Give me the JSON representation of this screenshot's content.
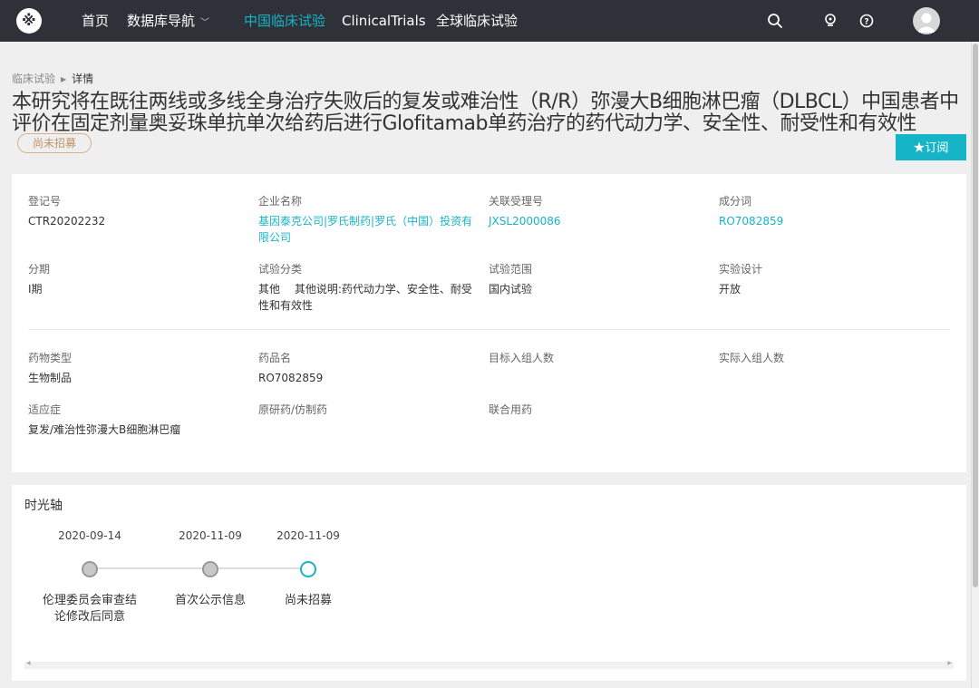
{
  "nav": {
    "items": [
      "首页",
      "数据库导航",
      "中国临床试验",
      "ClinicalTrials",
      "全球临床试验"
    ],
    "active_index": 2,
    "accent_color": "#16b4c7",
    "icons": [
      "search-icon",
      "bulb-icon",
      "help-icon",
      "user-avatar"
    ]
  },
  "breadcrumb": {
    "parent": "临床试验",
    "current": "详情"
  },
  "title": "本研究将在既往两线或多线全身治疗失败后的复发或难治性（R/R）弥漫大B细胞淋巴瘤（DLBCL）中国患者中评价在固定剂量奥妥珠单抗单次给药后进行Glofitamab单药治疗的药代动力学、安全性、耐受性和有效性",
  "status_badge": "尚未招募",
  "subscribe_label": "★订阅",
  "info": {
    "reg_no_label": "登记号",
    "reg_no": "CTR20202232",
    "company_label": "企业名称",
    "company": "基因泰克公司|罗氏制药|罗氏（中国）投资有限公司",
    "accept_no_label": "关联受理号",
    "accept_no": "JXSL2000086",
    "component_label": "成分词",
    "component": "RO7082859",
    "phase_label": "分期",
    "phase": "I期",
    "category_label": "试验分类",
    "category": "其他　 其他说明:药代动力学、安全性、耐受性和有效性",
    "scope_label": "试验范围",
    "scope": "国内试验",
    "design_label": "实验设计",
    "design": "开放",
    "drug_type_label": "药物类型",
    "drug_type": "生物制品",
    "drug_name_label": "药品名",
    "drug_name": "RO7082859",
    "target_enroll_label": "目标入组人数",
    "target_enroll": "",
    "actual_enroll_label": "实际入组人数",
    "actual_enroll": "",
    "indication_label": "适应症",
    "indication": "复发/难治性弥漫大B细胞淋巴瘤",
    "original_label": "原研药/仿制药",
    "original": "",
    "combo_label": "联合用药",
    "combo": ""
  },
  "timeline": {
    "heading": "时光轴",
    "events": [
      {
        "date": "2020-09-14",
        "text": "伦理委员会审查结论修改后同意"
      },
      {
        "date": "2020-11-09",
        "text": "首次公示信息"
      },
      {
        "date": "2020-11-09",
        "text": "尚未招募"
      }
    ]
  }
}
